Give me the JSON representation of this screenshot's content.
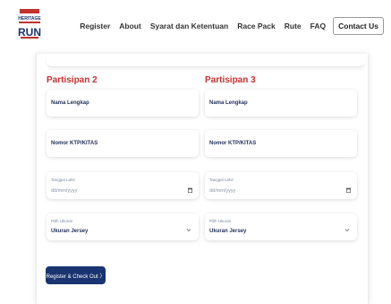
{
  "header": {
    "logo_lines": [
      "HERITAGE",
      "RUN"
    ],
    "nav": [
      "Register",
      "About",
      "Syarat dan Ketentuan",
      "Race Pack",
      "Rute",
      "FAQ"
    ],
    "contact_label": "Contact Us"
  },
  "participants": [
    {
      "title": "Partisipan 2",
      "name_placeholder": "Nama Lengkap",
      "id_placeholder": "Nomor KTP/KITAS",
      "dob_label": "Tanggal Lahir",
      "dob_placeholder": "dd/mm/yyyy",
      "size_label": "Pilih Ukuran",
      "size_value": "Ukuran Jersey"
    },
    {
      "title": "Partisipan 3",
      "name_placeholder": "Nama Lengkap",
      "id_placeholder": "Nomor KTP/KITAS",
      "dob_label": "Tanggal Lahir",
      "dob_placeholder": "dd/mm/yyyy",
      "size_label": "Pilih Ukuran",
      "size_value": "Ukuran Jersey"
    }
  ],
  "submit_label": "Register & Check Out 〉",
  "colors": {
    "accent_red": "#c2322f",
    "navy": "#1a3471"
  }
}
